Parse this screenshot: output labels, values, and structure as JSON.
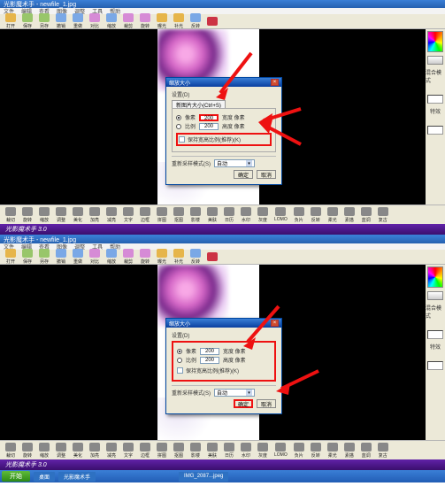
{
  "app": {
    "title": "光影魔术手 - newfile_1.jpg",
    "dialog_title": "缩放大小"
  },
  "menu": [
    "文件",
    "编辑",
    "查看",
    "图像",
    "调整",
    "工具",
    "帮助"
  ],
  "toolbar_top": [
    {
      "label": "打开",
      "color": "#e6b54a"
    },
    {
      "label": "保存",
      "color": "#98c66a"
    },
    {
      "label": "另存",
      "color": "#98c66a"
    },
    {
      "label": "撤销",
      "color": "#7aa8e6"
    },
    {
      "label": "重做",
      "color": "#7aa8e6"
    },
    {
      "label": "对比",
      "color": "#d68bd6"
    },
    {
      "label": "缩放",
      "color": "#7aa8e6"
    },
    {
      "label": "裁剪",
      "color": "#d68bd6"
    },
    {
      "label": "旋转",
      "color": "#d68bd6"
    },
    {
      "label": "曝光",
      "color": "#e6b54a"
    },
    {
      "label": "补光",
      "color": "#e6b54a"
    },
    {
      "label": "反转",
      "color": "#7aa8e6"
    },
    {
      "label": "",
      "color": "#cc3344"
    }
  ],
  "dialog": {
    "section": "设置(D)",
    "tab": "新图片大小(Ctrl+S)",
    "radio1": "像素",
    "radio2": "比例",
    "val_w": "200",
    "val_h": "200",
    "desc1": "宽度 像素",
    "desc2": "高度 像素",
    "lock_ratio": "保持宽高比例(推荐)(K)",
    "resample_lbl": "重新采样模式(S)",
    "resample_val": "自动",
    "ok": "确定",
    "cancel": "取消"
  },
  "palette": {
    "label1": "混合模式",
    "label2": "特效"
  },
  "toolbar_bottom": [
    "裁切",
    "旋转",
    "缩放",
    "调整",
    "美化",
    "加亮",
    "减亮",
    "文字",
    "边框",
    "拼图",
    "抠图",
    "影楼",
    "美肤",
    "日历",
    "水印",
    "灰度",
    "LOMO",
    "负片",
    "反转",
    "柔光",
    "素描",
    "蓝调",
    "复古"
  ],
  "banner_text": "光影魔术手 3.0",
  "taskbar": {
    "start": "开始",
    "items": [
      "桌面",
      "光影魔术手",
      "IMG_2087...jpeg"
    ]
  }
}
